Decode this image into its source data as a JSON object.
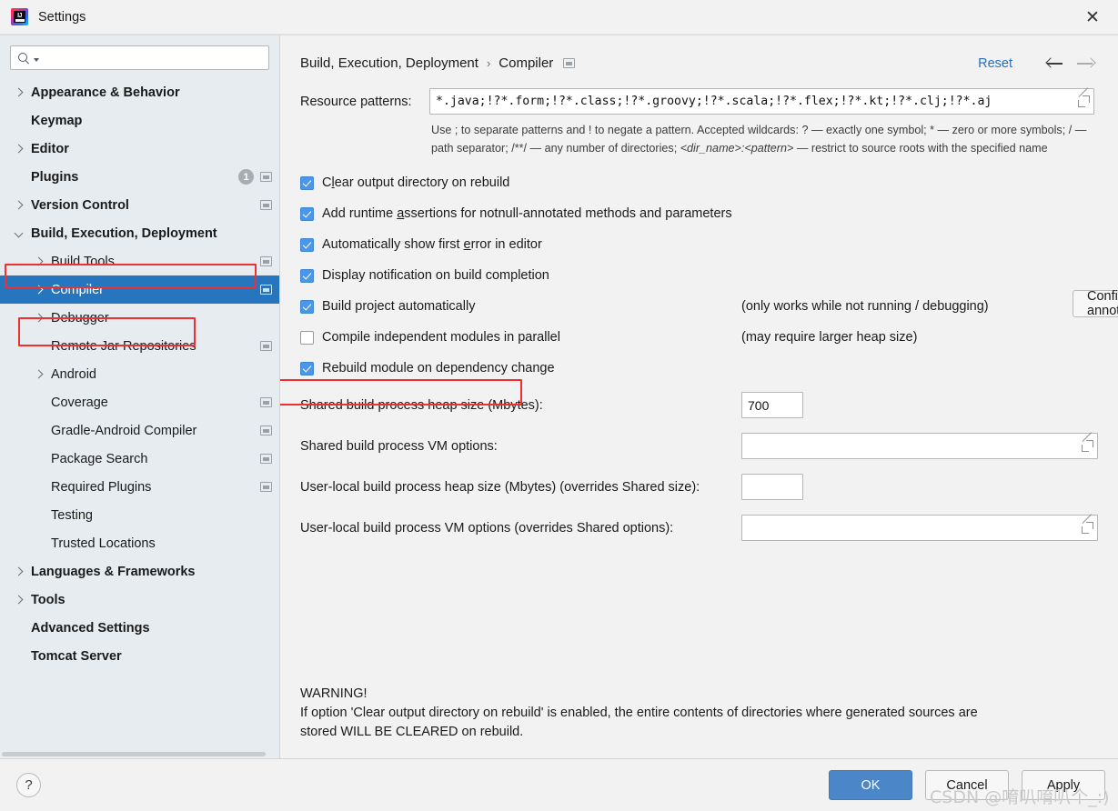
{
  "window": {
    "title": "Settings",
    "logo_text": "IJ",
    "close_label": "✕"
  },
  "sidebar": {
    "search": {
      "value": "",
      "placeholder": ""
    },
    "items": [
      {
        "label": "Appearance & Behavior",
        "arrow": "right",
        "indent": 0,
        "bold": true,
        "badge": "",
        "proj_icon": false,
        "selected": false
      },
      {
        "label": "Keymap",
        "arrow": "none",
        "indent": 0,
        "bold": true,
        "badge": "",
        "proj_icon": false,
        "selected": false
      },
      {
        "label": "Editor",
        "arrow": "right",
        "indent": 0,
        "bold": true,
        "badge": "",
        "proj_icon": false,
        "selected": false
      },
      {
        "label": "Plugins",
        "arrow": "none",
        "indent": 0,
        "bold": true,
        "badge": "1",
        "proj_icon": true,
        "selected": false
      },
      {
        "label": "Version Control",
        "arrow": "right",
        "indent": 0,
        "bold": true,
        "badge": "",
        "proj_icon": true,
        "selected": false
      },
      {
        "label": "Build, Execution, Deployment",
        "arrow": "down",
        "indent": 0,
        "bold": true,
        "badge": "",
        "proj_icon": false,
        "selected": false
      },
      {
        "label": "Build Tools",
        "arrow": "right",
        "indent": 1,
        "bold": false,
        "badge": "",
        "proj_icon": true,
        "selected": false
      },
      {
        "label": "Compiler",
        "arrow": "right",
        "indent": 1,
        "bold": false,
        "badge": "",
        "proj_icon": true,
        "selected": true
      },
      {
        "label": "Debugger",
        "arrow": "right",
        "indent": 1,
        "bold": false,
        "badge": "",
        "proj_icon": false,
        "selected": false
      },
      {
        "label": "Remote Jar Repositories",
        "arrow": "none",
        "indent": 1,
        "bold": false,
        "badge": "",
        "proj_icon": true,
        "selected": false
      },
      {
        "label": "Android",
        "arrow": "right",
        "indent": 1,
        "bold": false,
        "badge": "",
        "proj_icon": false,
        "selected": false
      },
      {
        "label": "Coverage",
        "arrow": "none",
        "indent": 1,
        "bold": false,
        "badge": "",
        "proj_icon": true,
        "selected": false
      },
      {
        "label": "Gradle-Android Compiler",
        "arrow": "none",
        "indent": 1,
        "bold": false,
        "badge": "",
        "proj_icon": true,
        "selected": false
      },
      {
        "label": "Package Search",
        "arrow": "none",
        "indent": 1,
        "bold": false,
        "badge": "",
        "proj_icon": true,
        "selected": false
      },
      {
        "label": "Required Plugins",
        "arrow": "none",
        "indent": 1,
        "bold": false,
        "badge": "",
        "proj_icon": true,
        "selected": false
      },
      {
        "label": "Testing",
        "arrow": "none",
        "indent": 1,
        "bold": false,
        "badge": "",
        "proj_icon": false,
        "selected": false
      },
      {
        "label": "Trusted Locations",
        "arrow": "none",
        "indent": 1,
        "bold": false,
        "badge": "",
        "proj_icon": false,
        "selected": false
      },
      {
        "label": "Languages & Frameworks",
        "arrow": "right",
        "indent": 0,
        "bold": true,
        "badge": "",
        "proj_icon": false,
        "selected": false
      },
      {
        "label": "Tools",
        "arrow": "right",
        "indent": 0,
        "bold": true,
        "badge": "",
        "proj_icon": false,
        "selected": false
      },
      {
        "label": "Advanced Settings",
        "arrow": "none",
        "indent": 0,
        "bold": true,
        "badge": "",
        "proj_icon": false,
        "selected": false
      },
      {
        "label": "Tomcat Server",
        "arrow": "none",
        "indent": 0,
        "bold": true,
        "badge": "",
        "proj_icon": false,
        "selected": false
      }
    ]
  },
  "header": {
    "breadcrumb_root": "Build, Execution, Deployment",
    "breadcrumb_sep": "›",
    "breadcrumb_leaf": "Compiler",
    "reset_label": "Reset"
  },
  "main": {
    "resource_patterns_label": "Resource patterns:",
    "resource_patterns_value": "*.java;!?*.form;!?*.class;!?*.groovy;!?*.scala;!?*.flex;!?*.kt;!?*.clj;!?*.aj",
    "hint_line1": "Use ; to separate patterns and ! to negate a pattern. Accepted wildcards: ? — exactly one symbol; * — zero or more",
    "hint_line2_a": "symbols; / — path separator; /**/ — any number of directories; ",
    "hint_line2_i": "<dir_name>:<pattern>",
    "hint_line2_b": " — restrict to source roots with",
    "hint_line3": "the specified name",
    "checkboxes": [
      {
        "label_pre": "C",
        "label_mn": "l",
        "label_post": "ear output directory on rebuild",
        "checked": true,
        "note": ""
      },
      {
        "label_pre": "Add runtime ",
        "label_mn": "a",
        "label_post": "ssertions for notnull-annotated methods and parameters",
        "checked": true,
        "note": ""
      },
      {
        "label_pre": "Automatically show first ",
        "label_mn": "e",
        "label_post": "rror in editor",
        "checked": true,
        "note": ""
      },
      {
        "label_pre": "Display notification on build completion",
        "label_mn": "",
        "label_post": "",
        "checked": true,
        "note": ""
      },
      {
        "label_pre": "Build project automatically",
        "label_mn": "",
        "label_post": "",
        "checked": true,
        "note": "(only works while not running / debugging)"
      },
      {
        "label_pre": "Compile independent modules in parallel",
        "label_mn": "",
        "label_post": "",
        "checked": false,
        "note": "(may require larger heap size)"
      },
      {
        "label_pre": "Rebuild module on dependency change",
        "label_mn": "",
        "label_post": "",
        "checked": true,
        "note": ""
      }
    ],
    "configure_annotations_pre": "C",
    "configure_annotations_mn": "",
    "configure_annotations_label": "Configure annotations...",
    "fields": [
      {
        "label": "Shared build process heap size (Mbytes):",
        "value": "700",
        "wide": false,
        "expandable": false
      },
      {
        "label": "Shared build process VM options:",
        "value": "",
        "wide": true,
        "expandable": true
      },
      {
        "label": "User-local build process heap size (Mbytes) (overrides Shared size):",
        "value": "",
        "wide": false,
        "expandable": false
      },
      {
        "label": "User-local build process VM options (overrides Shared options):",
        "value": "",
        "wide": true,
        "expandable": true
      }
    ],
    "warning_title": "WARNING!",
    "warning_line1": "If option 'Clear output directory on rebuild' is enabled, the entire contents of directories where generated sources are",
    "warning_line2": "stored WILL BE CLEARED on rebuild."
  },
  "footer": {
    "help_label": "?",
    "ok_label": "OK",
    "cancel_label": "Cancel",
    "apply_label": "Apply"
  },
  "watermark": {
    "text": "CSDN @唷叭唷叭个_:)"
  },
  "colors": {
    "accent_blue": "#2675bf",
    "link_blue": "#2470c0",
    "checkbox_blue": "#4a96e8",
    "highlight_red": "#f03030",
    "sidebar_bg": "#e7ecf0",
    "panel_bg": "#f2f2f2"
  }
}
